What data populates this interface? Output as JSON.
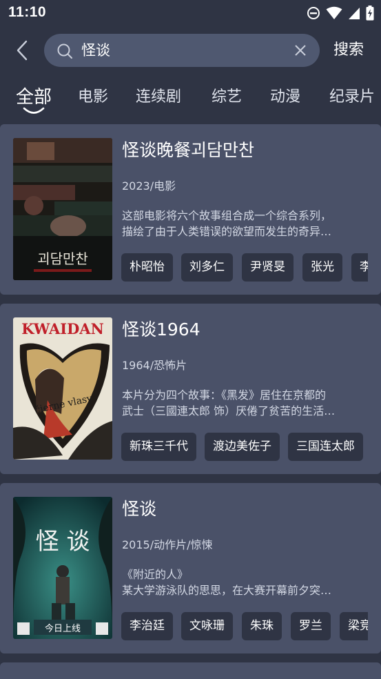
{
  "status": {
    "time": "11:10"
  },
  "search": {
    "query": "怪谈",
    "button_label": "搜索"
  },
  "tabs": [
    "全部",
    "电影",
    "连续剧",
    "综艺",
    "动漫",
    "纪录片"
  ],
  "results": [
    {
      "title": "怪谈晚餐괴담만찬",
      "meta": "2023/电影",
      "desc_line1": "这部电影将六个故事组合成一个综合系列，",
      "desc_line2": "描绘了由于人类错误的欲望而发生的奇异…",
      "poster_text": "괴담만찬",
      "actors": [
        "朴昭怡",
        "刘多仁",
        "尹贤旻",
        "张光",
        "李"
      ]
    },
    {
      "title": "怪谈1964",
      "meta": "1964/恐怖片",
      "desc_line1": "本片分为四个故事：《黑发》居住在京都的",
      "desc_line2": "武士（三國連太郎 饰）厌倦了贫苦的生活…",
      "poster_title": "KWAIDAN",
      "poster_sub": "čierne vlasy",
      "actors": [
        "新珠三千代",
        "渡边美佐子",
        "三国连太郎"
      ]
    },
    {
      "title": "怪谈",
      "meta": "2015/动作片/惊悚",
      "desc_line1": "《附近的人》",
      "desc_line2": "某大学游泳队的思思，在大赛开幕前夕突…",
      "poster_title": "怪 谈",
      "poster_sub": "今日上线",
      "actors": [
        "李治廷",
        "文咏珊",
        "朱珠",
        "罗兰",
        "梁竞"
      ]
    }
  ],
  "colors": {
    "background": "#2f3444",
    "card": "#4a5168",
    "search_box": "#4f5870",
    "chip": "#2f3444"
  },
  "icons": [
    "back-arrow-icon",
    "search-icon",
    "clear-icon",
    "dnd-icon",
    "wifi-icon",
    "signal-icon",
    "battery-icon"
  ]
}
